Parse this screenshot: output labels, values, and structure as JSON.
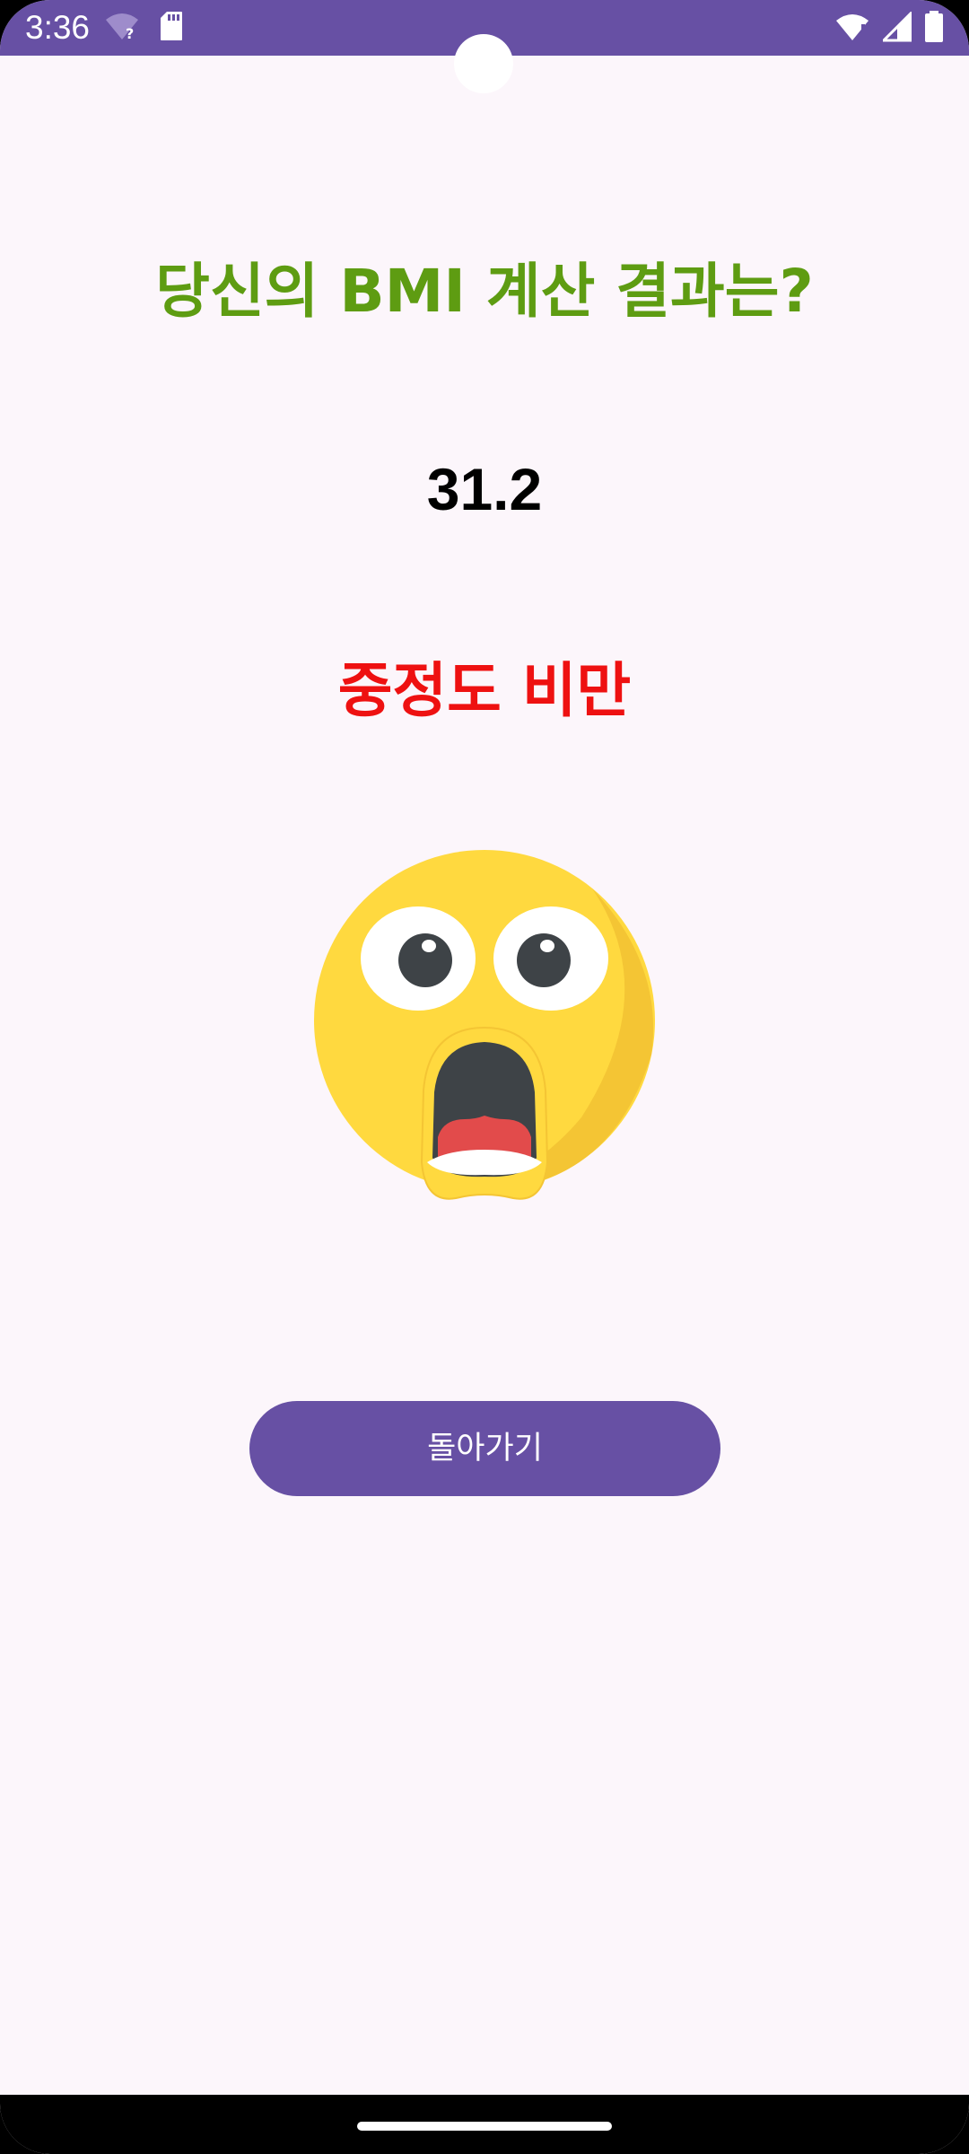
{
  "status_bar": {
    "time": "3:36",
    "background_color": "#6750A4",
    "left_icons": [
      "wifi-question-icon",
      "sd-card-icon"
    ],
    "right_icons": [
      "wifi-icon",
      "signal-icon",
      "battery-icon"
    ]
  },
  "result": {
    "title": "당신의 BMI 계산 결과는?",
    "bmi_value": "31.2",
    "category": "중정도 비만",
    "emoji_icon": "shocked-face-emoji-icon",
    "title_color": "#5E9C12",
    "category_color": "#EE1111"
  },
  "actions": {
    "back_button_label": "돌아가기",
    "button_color": "#6750A4"
  }
}
